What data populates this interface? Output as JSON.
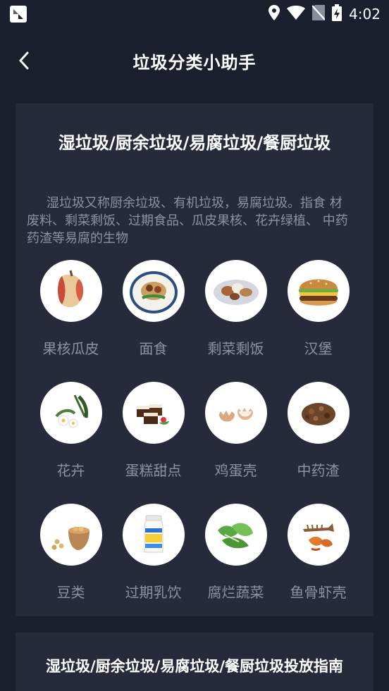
{
  "status_bar": {
    "time": "4:02"
  },
  "header": {
    "title": "垃圾分类小助手"
  },
  "category": {
    "title": "湿垃圾/厨余垃圾/易腐垃圾/餐厨垃圾",
    "description": "湿垃圾又称厨余垃圾、有机垃圾，易腐垃圾。指食 材废料、剩菜剩饭、过期食品、瓜皮果核、花卉绿植、 中药药渣等易腐的生物",
    "items": [
      {
        "label": "果核瓜皮",
        "icon": "apple-core-icon"
      },
      {
        "label": "面食",
        "icon": "noodles-icon"
      },
      {
        "label": "剩菜剩饭",
        "icon": "leftovers-icon"
      },
      {
        "label": "汉堡",
        "icon": "hamburger-icon"
      },
      {
        "label": "花卉",
        "icon": "flowers-icon"
      },
      {
        "label": "蛋糕甜点",
        "icon": "cake-icon"
      },
      {
        "label": "鸡蛋壳",
        "icon": "eggshell-icon"
      },
      {
        "label": "中药渣",
        "icon": "herb-residue-icon"
      },
      {
        "label": "豆类",
        "icon": "beans-icon"
      },
      {
        "label": "过期乳饮",
        "icon": "milk-drink-icon"
      },
      {
        "label": "腐烂蔬菜",
        "icon": "vegetables-icon"
      },
      {
        "label": "鱼骨虾壳",
        "icon": "fish-shrimp-icon"
      }
    ]
  },
  "guide": {
    "title": "湿垃圾/厨余垃圾/易腐垃圾/餐厨垃圾投放指南"
  }
}
